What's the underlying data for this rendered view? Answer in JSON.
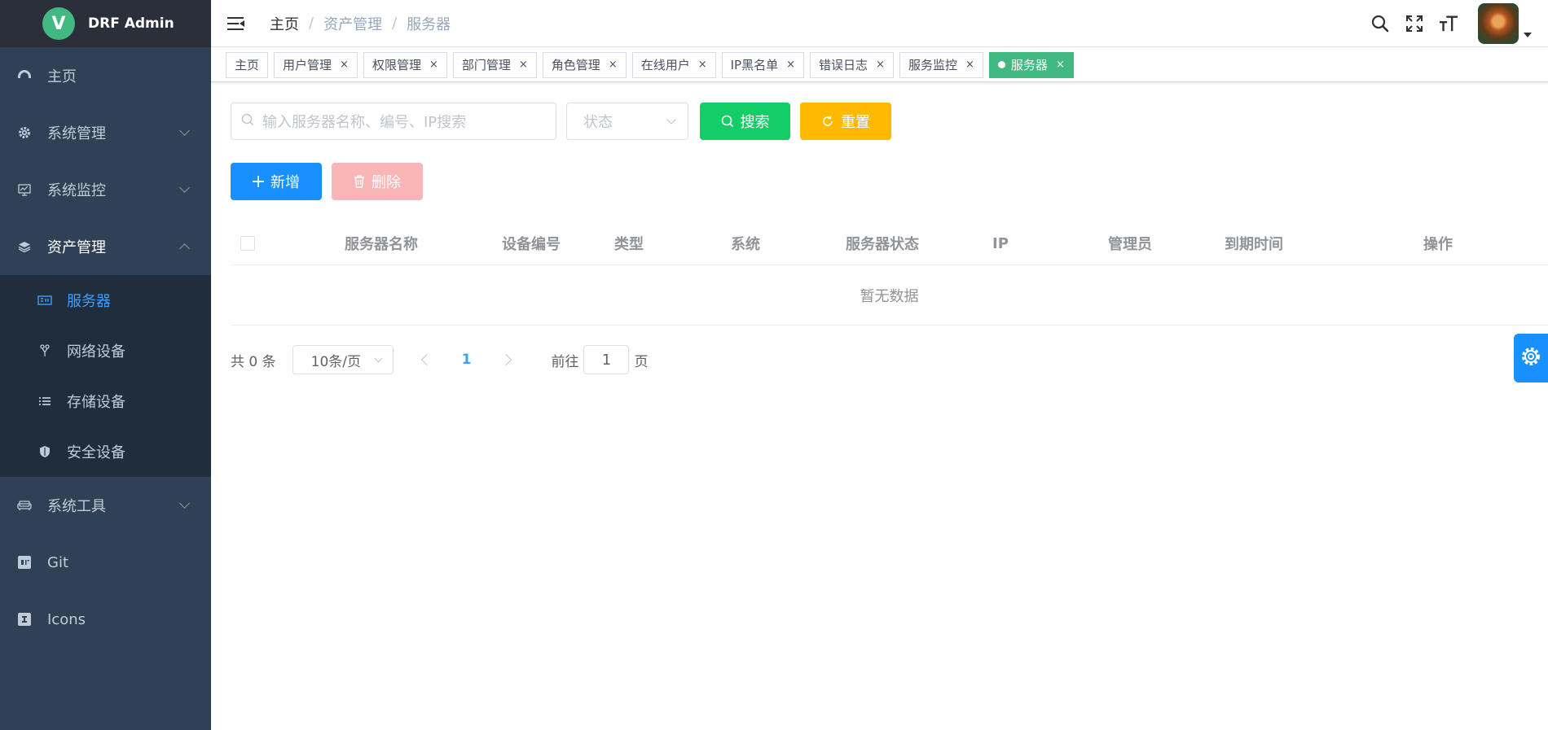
{
  "app": {
    "title": "DRF Admin",
    "logo_letter": "V"
  },
  "sidebar": {
    "items": [
      {
        "label": "主页",
        "icon": "dashboard-icon"
      },
      {
        "label": "系统管理",
        "icon": "gear-icon"
      },
      {
        "label": "系统监控",
        "icon": "monitor-icon"
      },
      {
        "label": "资产管理",
        "icon": "layers-icon"
      },
      {
        "label": "系统工具",
        "icon": "sofa-icon"
      },
      {
        "label": "Git",
        "icon": "git-icon"
      },
      {
        "label": "Icons",
        "icon": "icons-icon"
      }
    ],
    "asset_children": [
      {
        "label": "服务器",
        "icon": "server-icon"
      },
      {
        "label": "网络设备",
        "icon": "network-icon"
      },
      {
        "label": "存储设备",
        "icon": "storage-icon"
      },
      {
        "label": "安全设备",
        "icon": "shield-icon"
      }
    ]
  },
  "breadcrumb": [
    "主页",
    "资产管理",
    "服务器"
  ],
  "tags": [
    {
      "label": "主页"
    },
    {
      "label": "用户管理"
    },
    {
      "label": "权限管理"
    },
    {
      "label": "部门管理"
    },
    {
      "label": "角色管理"
    },
    {
      "label": "在线用户"
    },
    {
      "label": "IP黑名单"
    },
    {
      "label": "错误日志"
    },
    {
      "label": "服务监控"
    },
    {
      "label": "服务器"
    }
  ],
  "tag_close": "×",
  "filters": {
    "search_placeholder": "输入服务器名称、编号、IP搜索",
    "status_placeholder": "状态",
    "search_button": "搜索",
    "reset_button": "重置"
  },
  "actions": {
    "add_button": "新增",
    "delete_button": "删除"
  },
  "table": {
    "columns": [
      "服务器名称",
      "设备编号",
      "类型",
      "系统",
      "服务器状态",
      "IP",
      "管理员",
      "到期时间",
      "操作"
    ],
    "empty_text": "暂无数据"
  },
  "pagination": {
    "total_text": "共 0 条",
    "page_size": "10条/页",
    "current_page": "1",
    "goto_label": "前往",
    "goto_value": "1",
    "page_suffix": "页"
  },
  "colors": {
    "sidebar_bg": "#304156",
    "submenu_bg": "#1f2d3d",
    "active_menu": "#409eff",
    "active_tag": "#42b983",
    "search_btn": "#13ce66",
    "reset_btn": "#ffba00",
    "add_btn": "#1890ff",
    "delete_btn": "#fab6b6"
  }
}
